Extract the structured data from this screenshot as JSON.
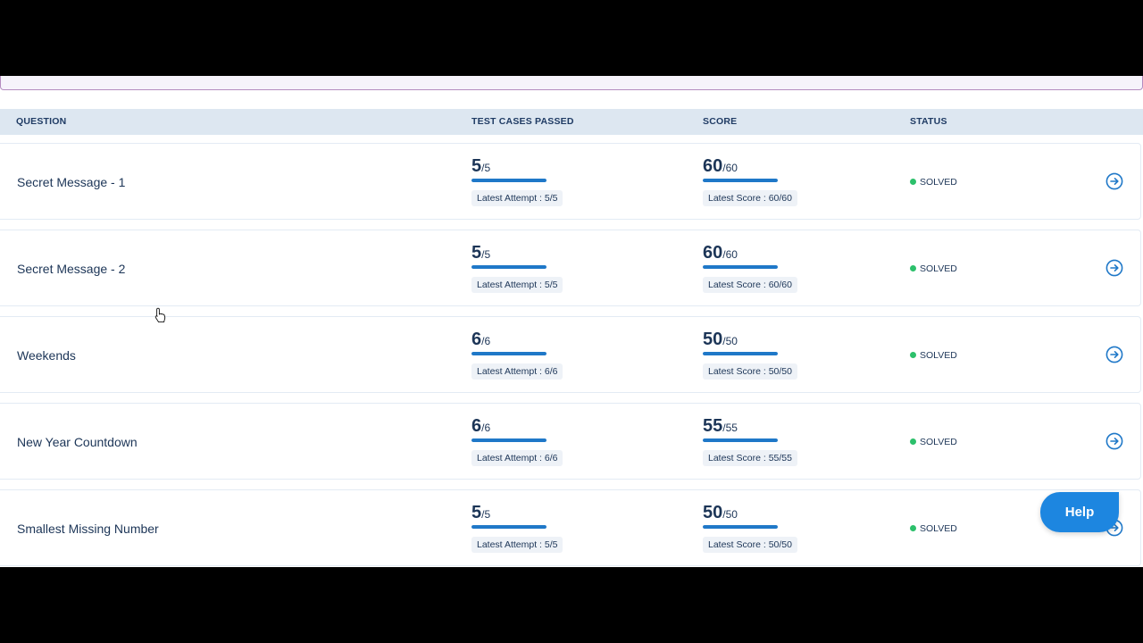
{
  "table": {
    "headers": {
      "question": "QUESTION",
      "tests": "TEST CASES PASSED",
      "score": "SCORE",
      "status": "STATUS"
    },
    "rows": [
      {
        "name": "Secret Message - 1",
        "tests_passed": "5",
        "tests_total": "/5",
        "tests_fraction": 1.0,
        "latest_attempt": "Latest Attempt : 5/5",
        "score": "60",
        "score_total": "/60",
        "score_fraction": 1.0,
        "latest_score": "Latest Score : 60/60",
        "status": "SOLVED"
      },
      {
        "name": "Secret Message - 2",
        "tests_passed": "5",
        "tests_total": "/5",
        "tests_fraction": 1.0,
        "latest_attempt": "Latest Attempt : 5/5",
        "score": "60",
        "score_total": "/60",
        "score_fraction": 1.0,
        "latest_score": "Latest Score : 60/60",
        "status": "SOLVED"
      },
      {
        "name": "Weekends",
        "tests_passed": "6",
        "tests_total": "/6",
        "tests_fraction": 1.0,
        "latest_attempt": "Latest Attempt : 6/6",
        "score": "50",
        "score_total": "/50",
        "score_fraction": 1.0,
        "latest_score": "Latest Score : 50/50",
        "status": "SOLVED"
      },
      {
        "name": "New Year Countdown",
        "tests_passed": "6",
        "tests_total": "/6",
        "tests_fraction": 1.0,
        "latest_attempt": "Latest Attempt : 6/6",
        "score": "55",
        "score_total": "/55",
        "score_fraction": 1.0,
        "latest_score": "Latest Score : 55/55",
        "status": "SOLVED"
      },
      {
        "name": "Smallest Missing Number",
        "tests_passed": "5",
        "tests_total": "/5",
        "tests_fraction": 1.0,
        "latest_attempt": "Latest Attempt : 5/5",
        "score": "50",
        "score_total": "/50",
        "score_fraction": 1.0,
        "latest_score": "Latest Score : 50/50",
        "status": "SOLVED"
      }
    ]
  },
  "help": {
    "label": "Help"
  },
  "icons": {
    "row_action": "arrow-circle-right-icon",
    "cursor": "hand-pointer-icon"
  },
  "colors": {
    "accent": "#1f78c8",
    "solved": "#2cc06b",
    "header_bg": "#dde7f1",
    "text": "#1c3557",
    "help_button": "#1d86e0"
  }
}
